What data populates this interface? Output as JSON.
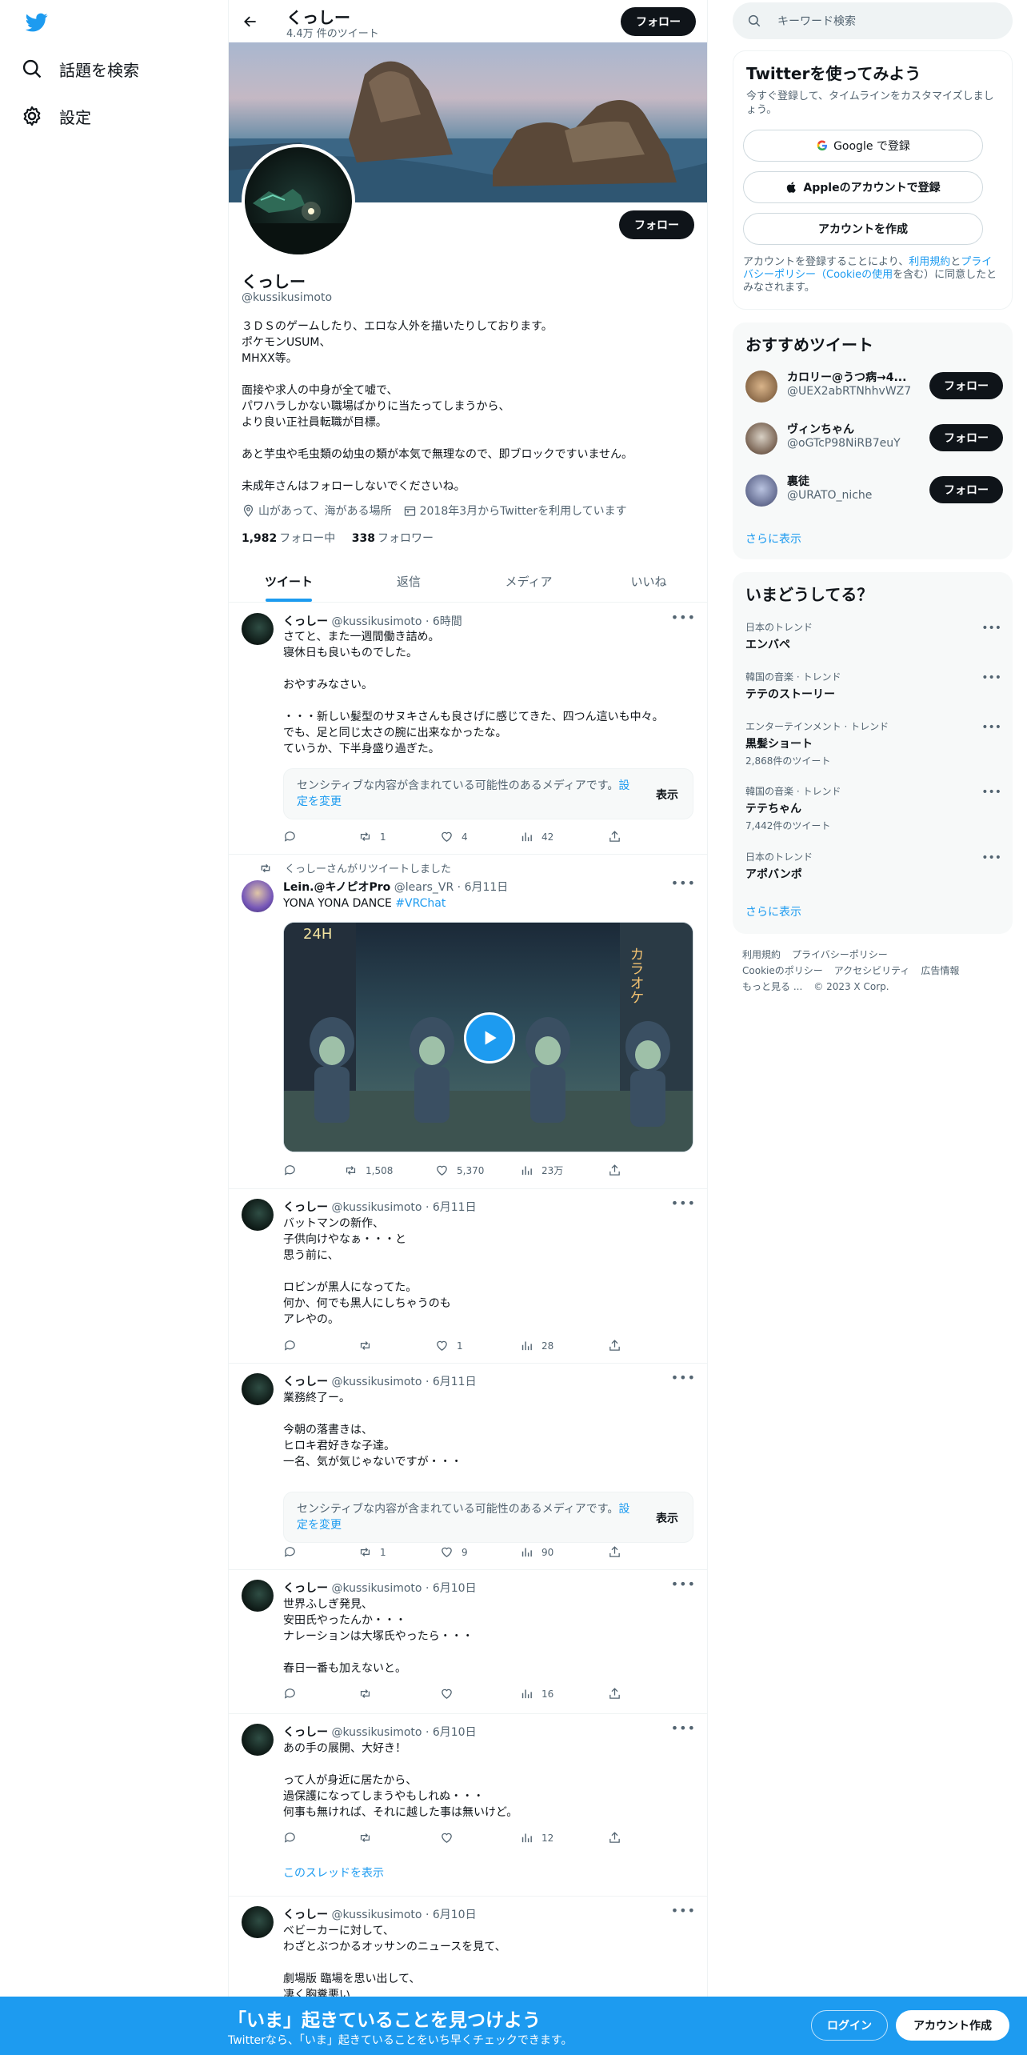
{
  "leftnav": {
    "logo_icon": "twitter-bird-icon",
    "items": [
      {
        "label": "話題を検索",
        "icon": "search-icon"
      },
      {
        "label": "設定",
        "icon": "gear-icon"
      }
    ]
  },
  "header": {
    "name": "くっしー",
    "tweet_count": "4.4万 件のツイート",
    "follow_label": "フォロー"
  },
  "profile": {
    "name": "くっしー",
    "handle": "@kussikusimoto",
    "follow_label": "フォロー",
    "bio": "３ＤＳのゲームしたり、エロな人外を描いたりしております。\nポケモンUSUM、\nMHXX等。\n\n面接や求人の中身が全て嘘で、\nパワハラしかない職場ばかりに当たってしまうから、\nより良い正社員転職が目標。\n\nあと芋虫や毛虫類の幼虫の類が本気で無理なので、即ブロックですいません。\n\n未成年さんはフォローしないでくださいね。",
    "location": "山があって、海がある場所",
    "joined": "2018年3月からTwitterを利用しています",
    "following_count": "1,982",
    "following_label": "フォロー中",
    "followers_count": "338",
    "followers_label": "フォロワー"
  },
  "tabs": [
    "ツイート",
    "返信",
    "メディア",
    "いいね"
  ],
  "tweets": [
    {
      "name": "くっしー",
      "handle": "@kussikusimoto",
      "time": "6時間",
      "text": "さてと、また一週間働き詰め。\n寝休日も良いものでした。\n\nおやすみなさい。\n\n・・・新しい髪型のサヌキさんも良さげに感じてきた、四つん這いも中々。\nでも、足と同じ太さの腕に出来なかったな。\nていうか、下半身盛り過ぎた。",
      "sensitive": "センシティブな内容が含まれている可能性のあるメディアです。",
      "settings_link": "設定を変更",
      "show_label": "表示",
      "replies": "",
      "retweets": "1",
      "likes": "4",
      "views": "42"
    },
    {
      "retweet_by": "くっしーさんがリツイートしました",
      "name": "Lein.@キノピオPro",
      "handle": "@lears_VR",
      "time": "6月11日",
      "text": "YONA YONA DANCE ",
      "hashtag": "#VRChat",
      "video_sign_left": "24H",
      "video_sign_right": "カラオケ",
      "replies": "",
      "retweets": "1,508",
      "likes": "5,370",
      "views": "23万"
    },
    {
      "name": "くっしー",
      "handle": "@kussikusimoto",
      "time": "6月11日",
      "text": "バットマンの新作、\n子供向けやなぁ・・・と\n思う前に、\n\nロビンが黒人になってた。\n何か、何でも黒人にしちゃうのも\nアレやの。",
      "replies": "",
      "retweets": "",
      "likes": "1",
      "views": "28"
    },
    {
      "name": "くっしー",
      "handle": "@kussikusimoto",
      "time": "6月11日",
      "text": "業務終了ー。\n\n今朝の落書きは、\nヒロキ君好きな子達。\n一名、気が気じゃないですが・・・",
      "sensitive": "センシティブな内容が含まれている可能性のあるメディアです。",
      "settings_link": "設定を変更",
      "show_label": "表示",
      "replies": "",
      "retweets": "1",
      "likes": "9",
      "views": "90"
    },
    {
      "name": "くっしー",
      "handle": "@kussikusimoto",
      "time": "6月10日",
      "text": "世界ふしぎ発見、\n安田氏やったんか・・・\nナレーションは大塚氏やったら・・・\n\n春日一番も加えないと。",
      "replies": "",
      "retweets": "",
      "likes": "",
      "views": "16"
    },
    {
      "name": "くっしー",
      "handle": "@kussikusimoto",
      "time": "6月10日",
      "text": "あの手の展開、大好き！\n\nって人が身近に居たから、\n過保護になってしまうやもしれぬ・・・\n何事も無ければ、それに越した事は無いけど。",
      "replies": "",
      "retweets": "",
      "likes": "",
      "views": "12",
      "thread_link": "このスレッドを表示"
    },
    {
      "name": "くっしー",
      "handle": "@kussikusimoto",
      "time": "6月10日",
      "text": "ベビーカーに対して、\nわざとぶつかるオッサンのニュースを見て、\n\n劇場版 臨場を思い出して、\n凄く胸糞悪い"
    }
  ],
  "right": {
    "search_placeholder": "キーワード検索",
    "signup_card": {
      "title": "Twitterを使ってみよう",
      "sub": "今すぐ登録して、タイムラインをカスタマイズしましょう。",
      "google": "Google で登録",
      "apple": "Appleのアカウントで登録",
      "create": "アカウントを作成",
      "terms_1": "アカウントを登録することにより、",
      "terms_link1": "利用規約",
      "terms_2": "と",
      "terms_link2": "プライバシーポリシー（Cookieの使用",
      "terms_3": "を含む）に同意したとみなされます。"
    },
    "recommend": {
      "title": "おすすめツイート",
      "items": [
        {
          "name": "カロリー@うつ病→4...",
          "handle": "@UEX2abRTNhhvWZ7",
          "follow": "フォロー"
        },
        {
          "name": "ヴィンちゃん",
          "handle": "@oGTcP98NiRB7euY",
          "follow": "フォロー"
        },
        {
          "name": "裏徒",
          "handle": "@URATO_niche",
          "follow": "フォロー"
        }
      ],
      "more": "さらに表示"
    },
    "trends": {
      "title": "いまどうしてる？",
      "items": [
        {
          "category": "日本のトレンド",
          "name": "エンバペ",
          "count": ""
        },
        {
          "category": "韓国の音楽 · トレンド",
          "name": "テテのストーリー",
          "count": ""
        },
        {
          "category": "エンターテインメント · トレンド",
          "name": "黒髪ショート",
          "count": "2,868件のツイート"
        },
        {
          "category": "韓国の音楽 · トレンド",
          "name": "テテちゃん",
          "count": "7,442件のツイート"
        },
        {
          "category": "日本のトレンド",
          "name": "アポバンポ",
          "count": ""
        }
      ],
      "more": "さらに表示"
    },
    "footer": {
      "line1": [
        "利用規約",
        "プライバシーポリシー"
      ],
      "line2": [
        "Cookieのポリシー",
        "アクセシビリティ",
        "広告情報"
      ],
      "line3": [
        "もっと見る ...",
        "© 2023 X Corp."
      ]
    }
  },
  "bottombar": {
    "title": "「いま」起きていることを見つけよう",
    "sub": "Twitterなら、「いま」起きていることをいち早くチェックできます。",
    "login": "ログイン",
    "signup": "アカウント作成"
  },
  "colors": {
    "accent": "#1d9bf0",
    "text": "#0f1419",
    "muted": "#536471"
  }
}
